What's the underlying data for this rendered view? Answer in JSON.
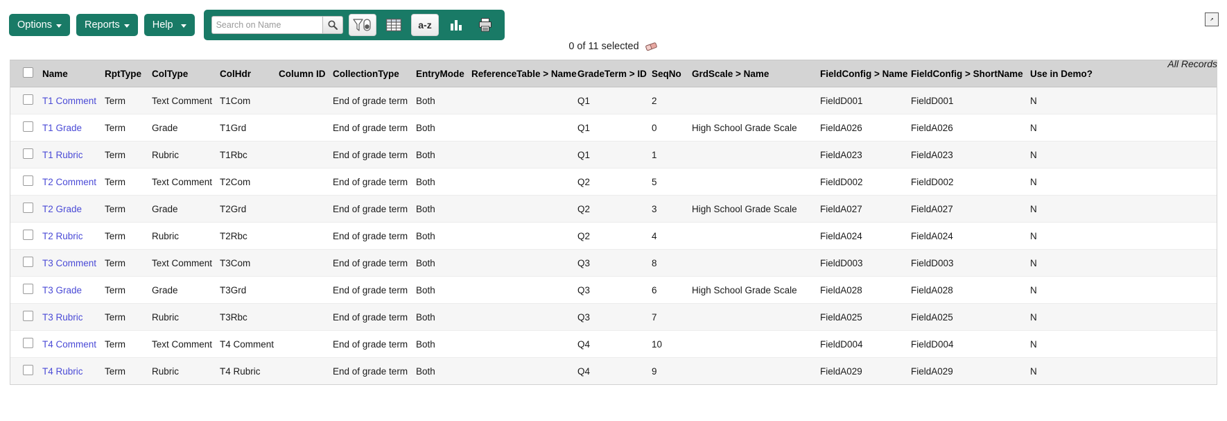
{
  "toolbar": {
    "buttons": [
      {
        "label": "Options",
        "name": "options-button"
      },
      {
        "label": "Reports",
        "name": "reports-button"
      },
      {
        "label": "Help",
        "name": "help-button"
      }
    ],
    "search": {
      "placeholder": "Search on Name",
      "value": "",
      "search_icon": "magnifier-icon"
    },
    "icons": [
      {
        "name": "filter-icon",
        "title": "Filter"
      },
      {
        "name": "grid-icon",
        "title": "Grid view"
      },
      {
        "name": "sort-az-icon",
        "title": "Sort A-Z"
      },
      {
        "name": "bar-chart-icon",
        "title": "Chart"
      },
      {
        "name": "print-icon",
        "title": "Print"
      }
    ],
    "expand_icon": "expand-arrow-icon",
    "accent_color": "#197a66"
  },
  "status": {
    "selected_text": "0 of 11 selected",
    "eraser_icon": "eraser-icon",
    "all_records": "All Records"
  },
  "table": {
    "columns": [
      "",
      "Name",
      "RptType",
      "ColType",
      "ColHdr",
      "Column ID",
      "CollectionType",
      "EntryMode",
      "ReferenceTable > Name",
      "GradeTerm > ID",
      "SeqNo",
      "GrdScale > Name",
      "FieldConfig > Name",
      "FieldConfig > ShortName",
      "Use in Demo?"
    ],
    "rows": [
      {
        "checked": false,
        "name": "T1 Comment",
        "rpttype": "Term",
        "coltype": "Text Comment",
        "colhdr": "T1Com",
        "columnid": "",
        "collectiontype": "End of grade term",
        "entrymode": "Both",
        "reftable": "",
        "gradeterm": "Q1",
        "seqno": "2",
        "grdscale": "",
        "fcname": "FieldD001",
        "fcshort": "FieldD001",
        "demo": "N"
      },
      {
        "checked": false,
        "name": "T1 Grade",
        "rpttype": "Term",
        "coltype": "Grade",
        "colhdr": "T1Grd",
        "columnid": "",
        "collectiontype": "End of grade term",
        "entrymode": "Both",
        "reftable": "",
        "gradeterm": "Q1",
        "seqno": "0",
        "grdscale": "High School Grade Scale",
        "fcname": "FieldA026",
        "fcshort": "FieldA026",
        "demo": "N"
      },
      {
        "checked": false,
        "name": "T1 Rubric",
        "rpttype": "Term",
        "coltype": "Rubric",
        "colhdr": "T1Rbc",
        "columnid": "",
        "collectiontype": "End of grade term",
        "entrymode": "Both",
        "reftable": "",
        "gradeterm": "Q1",
        "seqno": "1",
        "grdscale": "",
        "fcname": "FieldA023",
        "fcshort": "FieldA023",
        "demo": "N"
      },
      {
        "checked": false,
        "name": "T2 Comment",
        "rpttype": "Term",
        "coltype": "Text Comment",
        "colhdr": "T2Com",
        "columnid": "",
        "collectiontype": "End of grade term",
        "entrymode": "Both",
        "reftable": "",
        "gradeterm": "Q2",
        "seqno": "5",
        "grdscale": "",
        "fcname": "FieldD002",
        "fcshort": "FieldD002",
        "demo": "N"
      },
      {
        "checked": false,
        "name": "T2 Grade",
        "rpttype": "Term",
        "coltype": "Grade",
        "colhdr": "T2Grd",
        "columnid": "",
        "collectiontype": "End of grade term",
        "entrymode": "Both",
        "reftable": "",
        "gradeterm": "Q2",
        "seqno": "3",
        "grdscale": "High School Grade Scale",
        "fcname": "FieldA027",
        "fcshort": "FieldA027",
        "demo": "N"
      },
      {
        "checked": false,
        "name": "T2 Rubric",
        "rpttype": "Term",
        "coltype": "Rubric",
        "colhdr": "T2Rbc",
        "columnid": "",
        "collectiontype": "End of grade term",
        "entrymode": "Both",
        "reftable": "",
        "gradeterm": "Q2",
        "seqno": "4",
        "grdscale": "",
        "fcname": "FieldA024",
        "fcshort": "FieldA024",
        "demo": "N"
      },
      {
        "checked": false,
        "name": "T3 Comment",
        "rpttype": "Term",
        "coltype": "Text Comment",
        "colhdr": "T3Com",
        "columnid": "",
        "collectiontype": "End of grade term",
        "entrymode": "Both",
        "reftable": "",
        "gradeterm": "Q3",
        "seqno": "8",
        "grdscale": "",
        "fcname": "FieldD003",
        "fcshort": "FieldD003",
        "demo": "N"
      },
      {
        "checked": false,
        "name": "T3 Grade",
        "rpttype": "Term",
        "coltype": "Grade",
        "colhdr": "T3Grd",
        "columnid": "",
        "collectiontype": "End of grade term",
        "entrymode": "Both",
        "reftable": "",
        "gradeterm": "Q3",
        "seqno": "6",
        "grdscale": "High School Grade Scale",
        "fcname": "FieldA028",
        "fcshort": "FieldA028",
        "demo": "N"
      },
      {
        "checked": false,
        "name": "T3 Rubric",
        "rpttype": "Term",
        "coltype": "Rubric",
        "colhdr": "T3Rbc",
        "columnid": "",
        "collectiontype": "End of grade term",
        "entrymode": "Both",
        "reftable": "",
        "gradeterm": "Q3",
        "seqno": "7",
        "grdscale": "",
        "fcname": "FieldA025",
        "fcshort": "FieldA025",
        "demo": "N"
      },
      {
        "checked": false,
        "name": "T4 Comment",
        "rpttype": "Term",
        "coltype": "Text Comment",
        "colhdr": "T4 Comment",
        "columnid": "",
        "collectiontype": "End of grade term",
        "entrymode": "Both",
        "reftable": "",
        "gradeterm": "Q4",
        "seqno": "10",
        "grdscale": "",
        "fcname": "FieldD004",
        "fcshort": "FieldD004",
        "demo": "N"
      },
      {
        "checked": false,
        "name": "T4 Rubric",
        "rpttype": "Term",
        "coltype": "Rubric",
        "colhdr": "T4 Rubric",
        "columnid": "",
        "collectiontype": "End of grade term",
        "entrymode": "Both",
        "reftable": "",
        "gradeterm": "Q4",
        "seqno": "9",
        "grdscale": "",
        "fcname": "FieldA029",
        "fcshort": "FieldA029",
        "demo": "N"
      }
    ]
  }
}
